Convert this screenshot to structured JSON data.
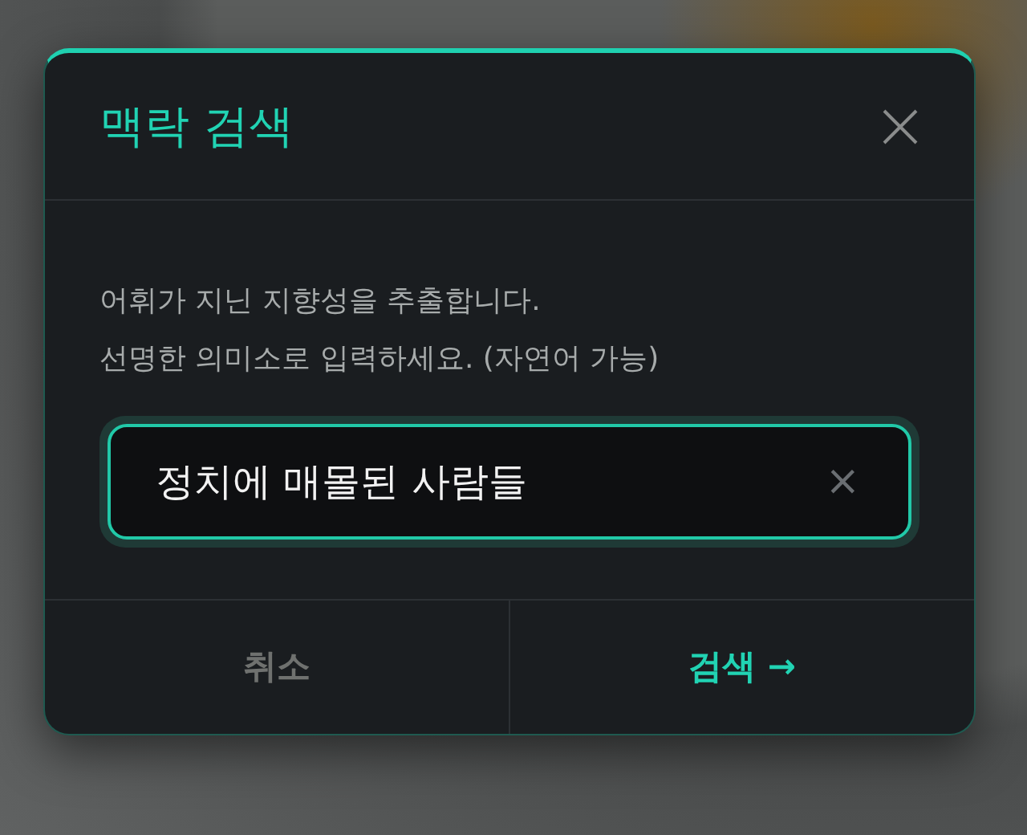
{
  "dialog": {
    "title": "맥락 검색",
    "description": [
      "어휘가 지닌 지향성을 추출합니다.",
      "선명한 의미소로 입력하세요. (자연어 가능)"
    ],
    "search": {
      "value": "정치에 매몰된 사람들",
      "clear_label": "×",
      "focused": true
    },
    "buttons": [
      {
        "label": "취소",
        "kind": "cancel"
      },
      {
        "label": "검색 →",
        "kind": "primary"
      }
    ]
  }
}
